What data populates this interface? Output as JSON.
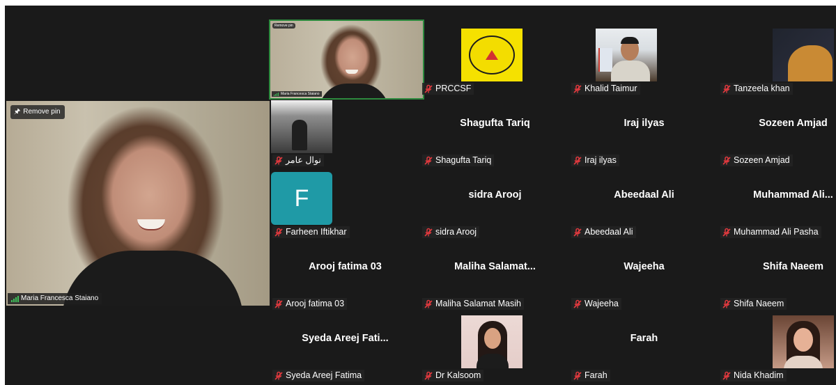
{
  "pinned": {
    "remove_pin_label": "Remove pin",
    "speaker_name": "Maria Francesca Staiano"
  },
  "active_video": {
    "remove_pin_label": "Remove pin",
    "speaker_name": "Maria Francesca Staiano"
  },
  "participants": [
    {
      "name": "PRCCSF",
      "display": "",
      "image": "logo"
    },
    {
      "name": "Khalid Taimur",
      "display": "",
      "image": "man"
    },
    {
      "name": "Tanzeela khan",
      "display": "",
      "image": "hijab"
    },
    {
      "name": "نوال عامر",
      "display": "",
      "image": "dark"
    },
    {
      "name": "Shagufta Tariq",
      "display": "Shagufta Tariq",
      "image": ""
    },
    {
      "name": "Iraj ilyas",
      "display": "Iraj ilyas",
      "image": ""
    },
    {
      "name": "Sozeen Amjad",
      "display": "Sozeen Amjad",
      "image": ""
    },
    {
      "name": "Farheen Iftikhar",
      "display": "",
      "image": "avatar",
      "avatar_letter": "F"
    },
    {
      "name": "sidra Arooj",
      "display": "sidra Arooj",
      "image": ""
    },
    {
      "name": "Abeedaal Ali",
      "display": "Abeedaal Ali",
      "image": ""
    },
    {
      "name": "Muhammad Ali Pasha",
      "display": "Muhammad  Ali...",
      "image": ""
    },
    {
      "name": "Arooj fatima 03",
      "display": "Arooj fatima 03",
      "image": ""
    },
    {
      "name": "Maliha Salamat Masih",
      "display": "Maliha  Salamat...",
      "image": ""
    },
    {
      "name": "Wajeeha",
      "display": "Wajeeha",
      "image": ""
    },
    {
      "name": "Shifa Naeem",
      "display": "Shifa Naeem",
      "image": ""
    },
    {
      "name": "Syeda Areej Fatima",
      "display": "Syeda Areej Fati...",
      "image": ""
    },
    {
      "name": "Dr Kalsoom",
      "display": "",
      "image": "woman1"
    },
    {
      "name": "Farah",
      "display": "Farah",
      "image": ""
    },
    {
      "name": "Nida Khadim",
      "display": "",
      "image": "woman2"
    }
  ],
  "colors": {
    "background": "#1a1a1a",
    "label_bg": "#232323",
    "muted_icon": "#e0393e",
    "active_speaker_border": "#2d8a3e",
    "avatar_bg": "#1f9aa6"
  }
}
